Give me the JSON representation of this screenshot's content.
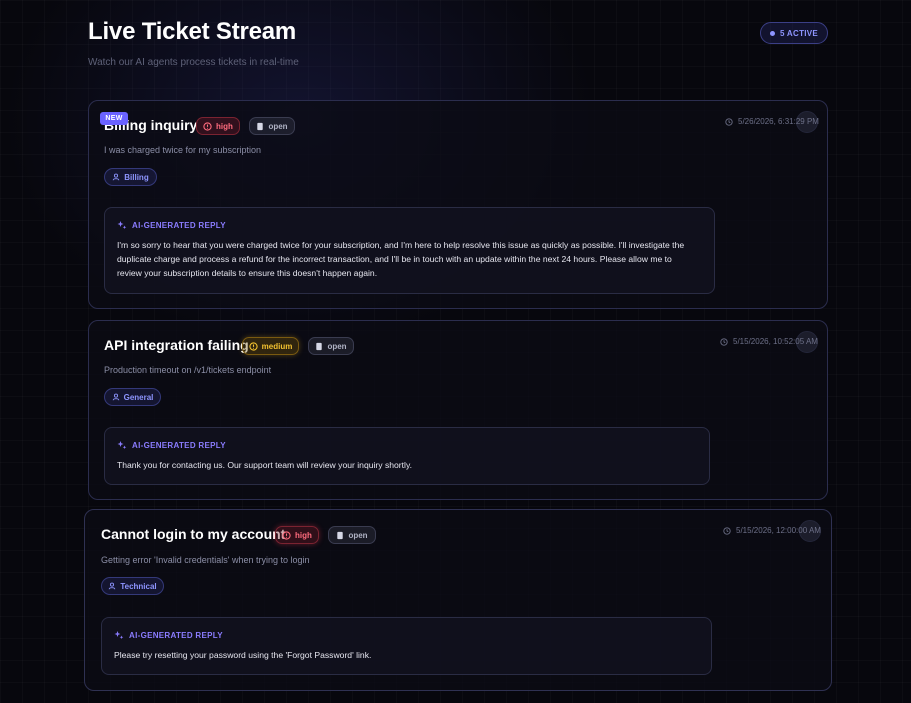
{
  "header": {
    "title": "Live Ticket Stream",
    "subtitle": "Watch our AI agents process tickets in real-time",
    "active_label": "5 ACTIVE"
  },
  "colors": {
    "accent": "#8e95ff",
    "high": "#ff6b7d",
    "medium": "#f3c230",
    "new_badge": "#6a62ff"
  },
  "tickets": [
    {
      "badge": "NEW",
      "title": "Billing inquiry",
      "priority": "high",
      "status": "open",
      "timestamp": "5/26/2026, 6:31:29 PM",
      "description": "I was charged twice for my subscription",
      "category": "Billing",
      "reply_label": "AI-GENERATED REPLY",
      "reply_lines": [
        "I'm so sorry to hear that you were charged twice for your subscription, and I'm here to help resolve this issue as quickly as possible. I'll investigate the",
        "duplicate charge and process a refund for the incorrect transaction, and I'll be in touch with an update within the next 24 hours. Please allow me to",
        "review your subscription details to ensure this doesn't happen again."
      ]
    },
    {
      "title": "API integration failing",
      "priority": "medium",
      "status": "open",
      "timestamp": "5/15/2026, 10:52:05 AM",
      "description": "Production timeout on /v1/tickets endpoint",
      "category": "General",
      "reply_label": "AI-GENERATED REPLY",
      "reply_lines": [
        "Thank you for contacting us. Our support team will review your inquiry shortly."
      ]
    },
    {
      "title": "Cannot login to my account",
      "priority": "high",
      "status": "open",
      "timestamp": "5/15/2026, 12:00:00 AM",
      "description": "Getting error 'Invalid credentials' when trying to login",
      "category": "Technical",
      "reply_label": "AI-GENERATED REPLY",
      "reply_lines": [
        "Please try resetting your password using the 'Forgot Password' link."
      ]
    }
  ]
}
